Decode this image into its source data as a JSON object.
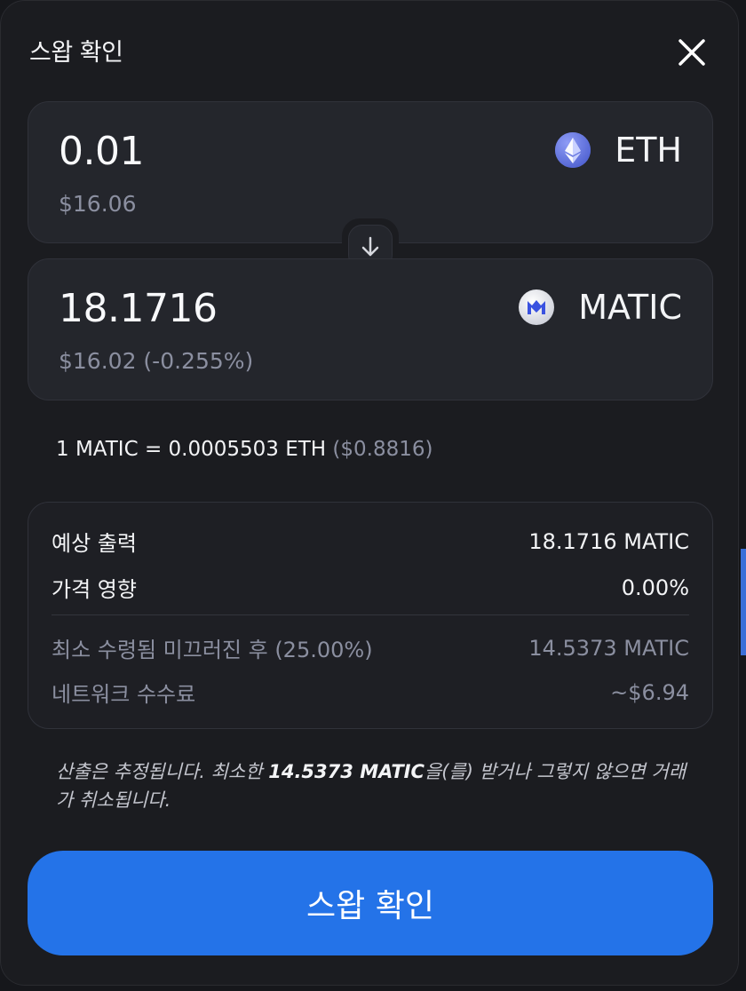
{
  "dialog": {
    "title": "스왑 확인",
    "close_icon": "close-icon"
  },
  "from": {
    "amount": "0.01",
    "usd": "$16.06",
    "token_symbol": "ETH",
    "token_icon": "eth-icon"
  },
  "swap_icon": "arrow-down-icon",
  "to": {
    "amount": "18.1716",
    "usd": "$16.02 (-0.255%)",
    "token_symbol": "MATIC",
    "token_icon": "matic-icon"
  },
  "rate": {
    "text": "1 MATIC = 0.0005503 ETH",
    "usd": "($0.8816)"
  },
  "details": {
    "expected_output_label": "예상 출력",
    "expected_output_value": "18.1716 MATIC",
    "price_impact_label": "가격 영향",
    "price_impact_value": "0.00%",
    "min_received_label": "최소 수령됨 미끄러진 후 (25.00%)",
    "min_received_value": "14.5373 MATIC",
    "network_fee_label": "네트워크 수수료",
    "network_fee_value": "~$6.94"
  },
  "note": {
    "prefix": "산출은 추정됩니다. 최소한 ",
    "amount": "14.5373 MATIC",
    "suffix": "을(를) 받거나 그렇지 않으면 거래가 취소됩니다."
  },
  "confirm_button": "스왑 확인",
  "colors": {
    "accent": "#2473e8",
    "background": "#1b1c20",
    "card": "#24262c",
    "muted_text": "#8b8fa0"
  }
}
